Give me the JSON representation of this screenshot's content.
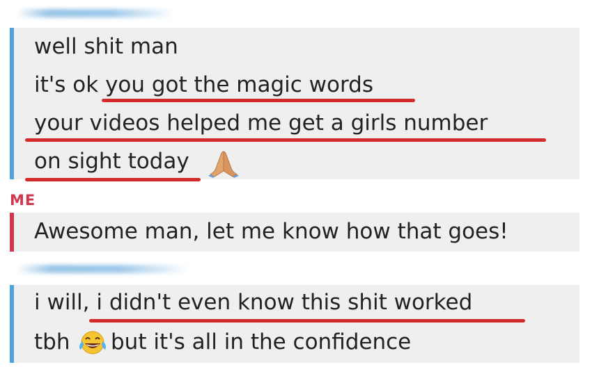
{
  "colors": {
    "friend_accent": "#4fa3da",
    "me_accent": "#d0374e",
    "underline": "#d32b2b",
    "bubble_bg": "#efefef",
    "text": "#222222"
  },
  "messages": [
    {
      "sender": "friend",
      "lines": [
        "well shit man",
        "it's ok you got the magic words",
        "your videos helped me get a girls number",
        "on sight today"
      ],
      "emoji": "folded-hands-icon"
    },
    {
      "sender": "me",
      "sender_label": "ME",
      "lines": [
        "Awesome man, let me know how that goes!"
      ]
    },
    {
      "sender": "friend",
      "lines": [
        "i will, i didn't even know this shit worked",
        "tbh",
        "but it's all in the confidence"
      ],
      "emoji": "tears-of-joy-icon"
    }
  ]
}
